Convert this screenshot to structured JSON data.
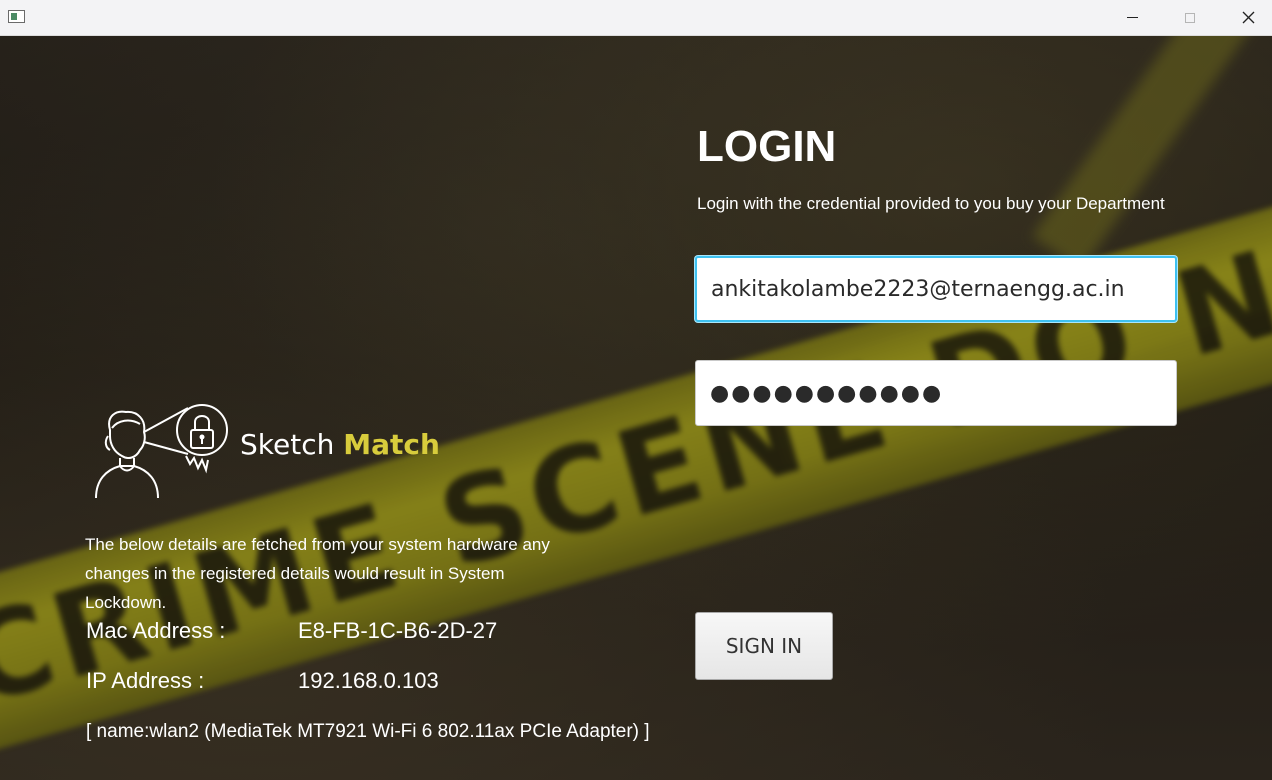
{
  "titlebar": {
    "icon": "app-window-icon",
    "minimize_icon": "minimize-icon",
    "maximize_icon": "maximize-icon",
    "close_icon": "close-icon",
    "close_glyph": "✕"
  },
  "login": {
    "title": "LOGIN",
    "subtitle": "Login with the credential provided to you buy your Department",
    "email_value": "ankitakolambe2223@ternaengg.ac.in",
    "password_value": "●●●●●●●●●●●",
    "signin_label": "SIGN IN"
  },
  "brand": {
    "name_part1": "Sketch",
    "name_part2": "Match",
    "logo_icon": "person-lock-icon",
    "accent_color": "#d8cc3c"
  },
  "system_info": {
    "notice": "The below details are fetched from your system hardware any changes in the registered details would result in System Lockdown.",
    "mac_label": "Mac Address :",
    "mac_value": "E8-FB-1C-B6-2D-27",
    "ip_label": "IP Address    :",
    "ip_value": "192.168.0.103",
    "adapter": "[ name:wlan2 (MediaTek MT7921 Wi-Fi 6 802.11ax PCIe Adapter) ]"
  },
  "background": {
    "tape_text": "CRIME SCENE DO NOT CROSS",
    "tape_color": "#8c8818"
  }
}
